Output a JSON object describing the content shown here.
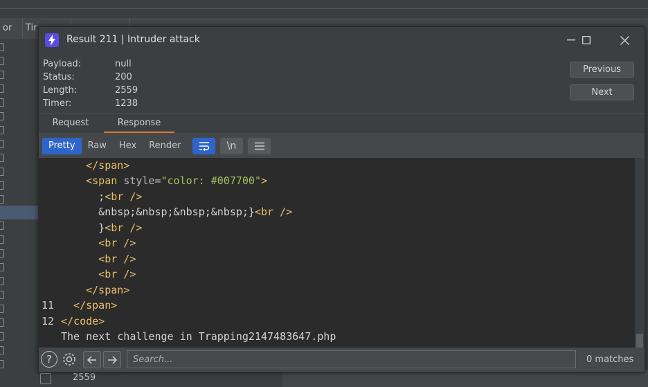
{
  "background": {
    "columns": [
      "or",
      "Tir"
    ],
    "bottom_row_value": "2559"
  },
  "window": {
    "title": "Result 211 | Intruder attack",
    "icon": "burp-bolt-icon"
  },
  "meta": {
    "payload_label": "Payload:",
    "payload_value": "null",
    "status_label": "Status:",
    "status_value": "200",
    "length_label": "Length:",
    "length_value": "2559",
    "timer_label": "Timer:",
    "timer_value": "1238"
  },
  "nav": {
    "previous": "Previous",
    "next": "Next"
  },
  "tabs": {
    "request": "Request",
    "response": "Response"
  },
  "toolbar": {
    "pretty": "Pretty",
    "raw": "Raw",
    "hex": "Hex",
    "render": "Render",
    "newline_label": "\\n"
  },
  "code_lines": [
    {
      "ln": "",
      "t1": "    </span>"
    },
    {
      "ln": "",
      "t1": "    <span ",
      "attr": "style=",
      "str": "\"color: #007700\"",
      "t2": ">"
    },
    {
      "ln": "",
      "txt": "      ;",
      "t1": "<br />"
    },
    {
      "ln": "",
      "txt": "      &nbsp;&nbsp;&nbsp;&nbsp;}",
      "t1": "<br />"
    },
    {
      "ln": "",
      "txt": "      }",
      "t1": "<br />"
    },
    {
      "ln": "",
      "t1": "      <br />"
    },
    {
      "ln": "",
      "t1": "      <br />"
    },
    {
      "ln": "",
      "t1": "      <br />"
    },
    {
      "ln": "",
      "t1": "    </span>"
    },
    {
      "ln": "11",
      "t1": "  </span>"
    },
    {
      "ln": "12",
      "t1": "</code>"
    },
    {
      "ln": "",
      "txt": "The next challenge in Trapping2147483647.php"
    }
  ],
  "bottom": {
    "search_placeholder": "Search...",
    "matches": "0 matches"
  }
}
